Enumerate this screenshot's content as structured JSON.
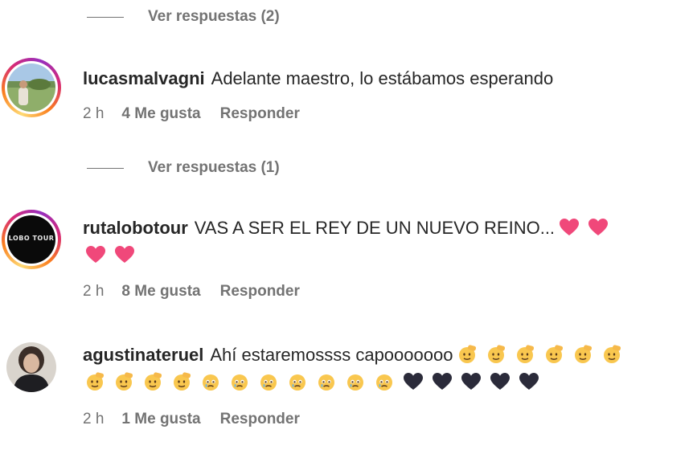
{
  "view_replies_top": {
    "label": "Ver respuestas (2)"
  },
  "comments": [
    {
      "username": "lucasmalvagni",
      "text": "Adelante maestro, lo estábamos esperando",
      "time": "2 h",
      "likes": "4 Me gusta",
      "reply": "Responder",
      "view_replies": "Ver respuestas (1)"
    },
    {
      "username": "rutalobotour",
      "text": "VAS A SER EL REY DE UN NUEVO REINO...",
      "emojis": [
        "pink-heart",
        "pink-heart",
        "pink-heart",
        "pink-heart"
      ],
      "avatar_text": "LOBO TOUR",
      "time": "2 h",
      "likes": "8 Me gusta",
      "reply": "Responder"
    },
    {
      "username": "agustinateruel",
      "text": "Ahí estaremossss capooooooo",
      "emojis_line1": [
        "saluting-face",
        "saluting-face",
        "saluting-face",
        "saluting-face",
        "saluting-face",
        "saluting-face"
      ],
      "emojis_line2": [
        "saluting-face",
        "saluting-face",
        "saluting-face",
        "saluting-face",
        "face-holding-back-tears",
        "face-holding-back-tears",
        "face-holding-back-tears",
        "face-holding-back-tears",
        "face-holding-back-tears",
        "face-holding-back-tears",
        "face-holding-back-tears",
        "black-heart",
        "black-heart",
        "black-heart",
        "black-heart",
        "black-heart"
      ],
      "time": "2 h",
      "likes": "1 Me gusta",
      "reply": "Responder"
    }
  ],
  "colors": {
    "muted": "#737373",
    "text": "#262626",
    "heart": "#f0487a",
    "black_heart": "#2b2b3a",
    "emoji_face": "#f9c74f"
  }
}
